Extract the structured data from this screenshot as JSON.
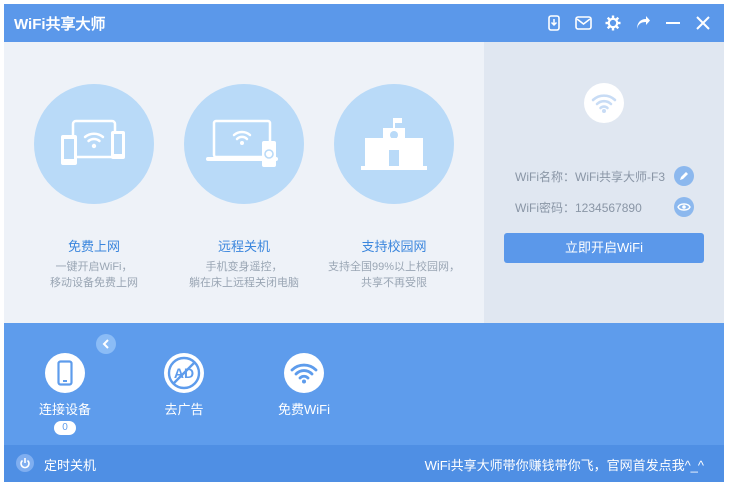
{
  "app": {
    "title": "WiFi共享大师"
  },
  "titlebar": {
    "icons": [
      "phone-download-icon",
      "mail-icon",
      "gear-icon",
      "share-icon",
      "minimize-icon",
      "close-icon"
    ]
  },
  "features": [
    {
      "title": "免费上网",
      "desc1": "一键开启WiFi，",
      "desc2": "移动设备免费上网",
      "icon": "devices-icon"
    },
    {
      "title": "远程关机",
      "desc1": "手机变身遥控，",
      "desc2": "躺在床上远程关闭电脑",
      "icon": "laptop-remote-icon"
    },
    {
      "title": "支持校园网",
      "desc1": "支持全国99%以上校园网，",
      "desc2": "共享不再受限",
      "icon": "school-icon"
    }
  ],
  "panel": {
    "wifi_name_label": "WiFi名称：",
    "wifi_name": "WiFi共享大师-F3",
    "wifi_pwd_label": "WiFi密码：",
    "wifi_pwd": "1234567890",
    "start_button": "立即开启WiFi"
  },
  "tools": [
    {
      "label": "连接设备",
      "icon": "phone-icon"
    },
    {
      "label": "去广告",
      "icon": "no-ad-icon"
    },
    {
      "label": "免费WiFi",
      "icon": "wifi-icon"
    }
  ],
  "connected_count": "0",
  "status": {
    "timer_label": "定时关机",
    "promo": "WiFi共享大师带你赚钱带你飞，官网首发点我^_^"
  },
  "colors": {
    "accent": "#5b98ea",
    "circle": "#b9daf8",
    "link": "#3b86dd"
  }
}
